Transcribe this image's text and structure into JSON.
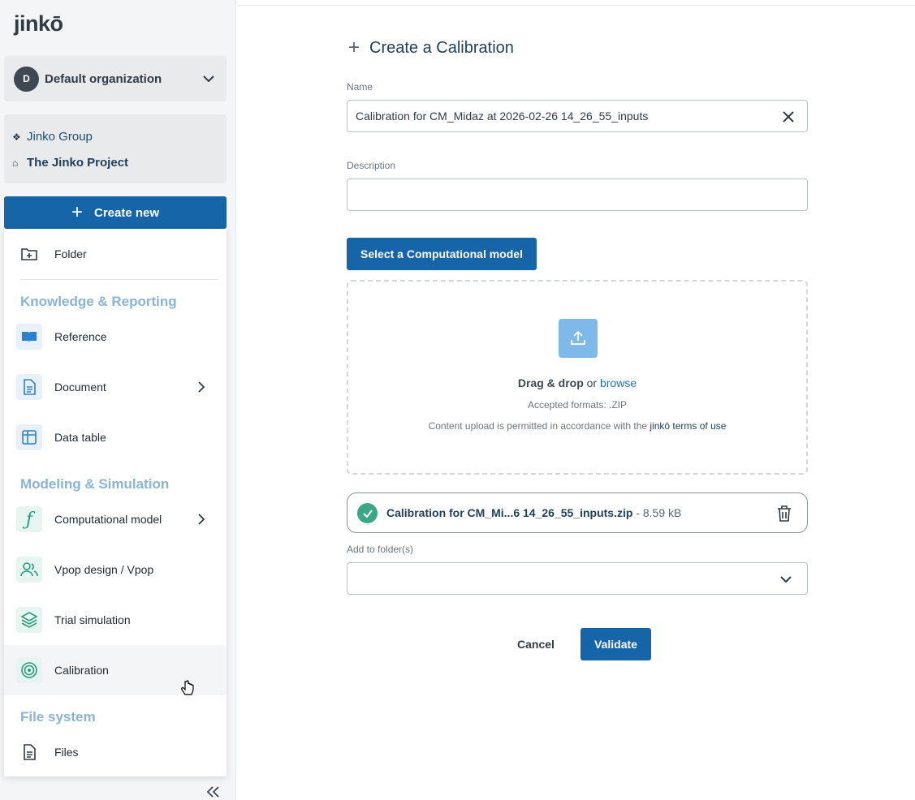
{
  "app": {
    "logo": "jinkō"
  },
  "org": {
    "avatar": "D",
    "name": "Default organization"
  },
  "project": {
    "group": "Jinko Group",
    "group_icon": "❖",
    "name": "The Jinko Project",
    "name_icon": "⌂"
  },
  "create_new": {
    "label": "Create new"
  },
  "menu": {
    "folder": "Folder",
    "section_knowledge": "Knowledge & Reporting",
    "reference": "Reference",
    "document": "Document",
    "data_table": "Data table",
    "section_modeling": "Modeling & Simulation",
    "computational_model": "Computational model",
    "vpop": "Vpop design / Vpop",
    "trial_simulation": "Trial simulation",
    "calibration": "Calibration",
    "section_files": "File system",
    "files": "Files"
  },
  "form": {
    "title": "Create a Calibration",
    "name_label": "Name",
    "name_value": "Calibration for CM_Midaz at 2026-02-26 14_26_55_inputs",
    "description_label": "Description",
    "description_value": "",
    "select_model_label": "Select a Computational model",
    "drop_bold": "Drag & drop",
    "drop_or": " or ",
    "drop_browse": "browse",
    "accepted_formats": "Accepted formats: .ZIP",
    "terms_prefix": "Content upload is permitted in accordance with the ",
    "terms_link": "jinkō terms of use",
    "file_name": "Calibration for CM_Mi...6 14_26_55_inputs.zip",
    "file_size": " - 8.59 kB",
    "folders_label": "Add to folder(s)",
    "cancel_label": "Cancel",
    "validate_label": "Validate"
  },
  "colors": {
    "primary": "#1565a8",
    "section": "#8ab4d4",
    "success": "#3aa884"
  }
}
